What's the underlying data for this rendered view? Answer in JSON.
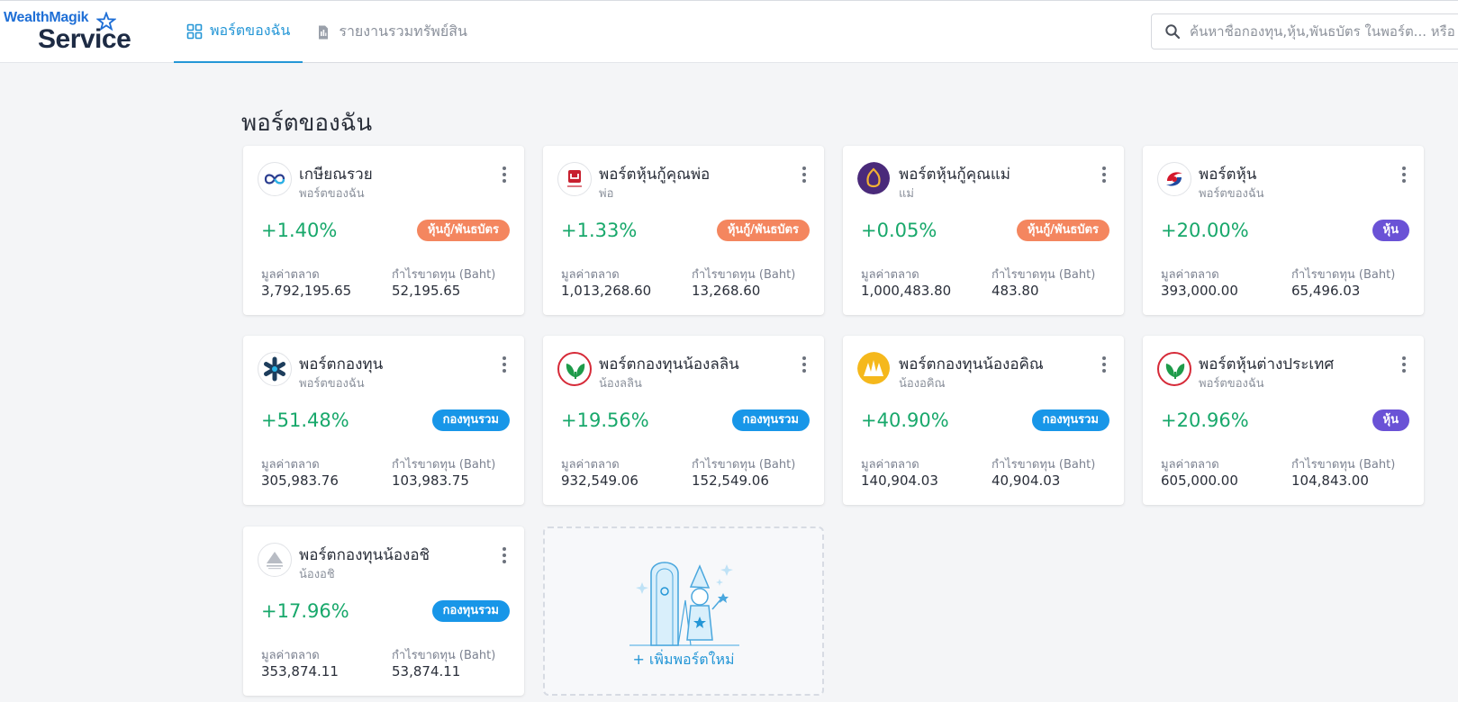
{
  "app": {
    "logo_top": "WealthMagik",
    "logo_bottom": "Service"
  },
  "tabs": [
    {
      "label": "พอร์ตของฉัน",
      "active": true
    },
    {
      "label": "รายงานรวมทรัพย์สิน",
      "active": false
    }
  ],
  "search": {
    "placeholder": "ค้นหาชื่อกองทุน,หุ้น,พันธบัตร ในพอร์ต... หรือ"
  },
  "page": {
    "title": "พอร์ตของฉัน",
    "market_value_label": "มูลค่าตลาด",
    "profit_label": "กำไรขาดทุน (Baht)",
    "add_label": "+ เพิ่มพอร์ตใหม่"
  },
  "colors": {
    "accent": "#2496d6",
    "positive": "#18a86b",
    "tag_bond": "#f4865f",
    "tag_fund": "#1896e8",
    "tag_stock": "#6a52d6"
  },
  "cards": [
    {
      "name": "เกษียณรวย",
      "owner": "พอร์ตของฉัน",
      "pct": "+1.40%",
      "tag": "หุ้นกู้/พันธบัตร",
      "tag_type": "bond",
      "market_value": "3,792,195.65",
      "profit": "52,195.65",
      "icon": "infinity-logo-icon"
    },
    {
      "name": "พอร์ตหุ้นกู้คุณพ่อ",
      "owner": "พ่อ",
      "pct": "+1.33%",
      "tag": "หุ้นกู้/พันธบัตร",
      "tag_type": "bond",
      "market_value": "1,013,268.60",
      "profit": "13,268.60",
      "icon": "red-square-logo-icon"
    },
    {
      "name": "พอร์ตหุ้นกู้คุณแม่",
      "owner": "แม่",
      "pct": "+0.05%",
      "tag": "หุ้นกู้/พันธบัตร",
      "tag_type": "bond",
      "market_value": "1,000,483.80",
      "profit": "483.80",
      "icon": "purple-bank-logo-icon"
    },
    {
      "name": "พอร์ตหุ้น",
      "owner": "พอร์ตของฉัน",
      "pct": "+20.00%",
      "tag": "หุ้น",
      "tag_type": "stock",
      "market_value": "393,000.00",
      "profit": "65,496.03",
      "icon": "red-blue-swirl-logo-icon"
    },
    {
      "name": "พอร์ตกองทุน",
      "owner": "พอร์ตของฉัน",
      "pct": "+51.48%",
      "tag": "กองทุนรวม",
      "tag_type": "fund",
      "market_value": "305,983.76",
      "profit": "103,983.75",
      "icon": "asterisk-logo-icon"
    },
    {
      "name": "พอร์ตกองทุนน้องลลิน",
      "owner": "น้องลลิน",
      "pct": "+19.56%",
      "tag": "กองทุนรวม",
      "tag_type": "fund",
      "market_value": "932,549.06",
      "profit": "152,549.06",
      "icon": "green-leaf-logo-icon"
    },
    {
      "name": "พอร์ตกองทุนน้องอคิณ",
      "owner": "น้องอคิณ",
      "pct": "+40.90%",
      "tag": "กองทุนรวม",
      "tag_type": "fund",
      "market_value": "140,904.03",
      "profit": "40,904.03",
      "icon": "yellow-bank-logo-icon"
    },
    {
      "name": "พอร์ตหุ้นต่างประเทศ",
      "owner": "พอร์ตของฉัน",
      "pct": "+20.96%",
      "tag": "หุ้น",
      "tag_type": "stock",
      "market_value": "605,000.00",
      "profit": "104,843.00",
      "icon": "green-leaf-logo-icon"
    },
    {
      "name": "พอร์ตกองทุนน้องอชิ",
      "owner": "น้องอชิ",
      "pct": "+17.96%",
      "tag": "กองทุนรวม",
      "tag_type": "fund",
      "market_value": "353,874.11",
      "profit": "53,874.11",
      "icon": "grey-triangle-logo-icon"
    }
  ]
}
